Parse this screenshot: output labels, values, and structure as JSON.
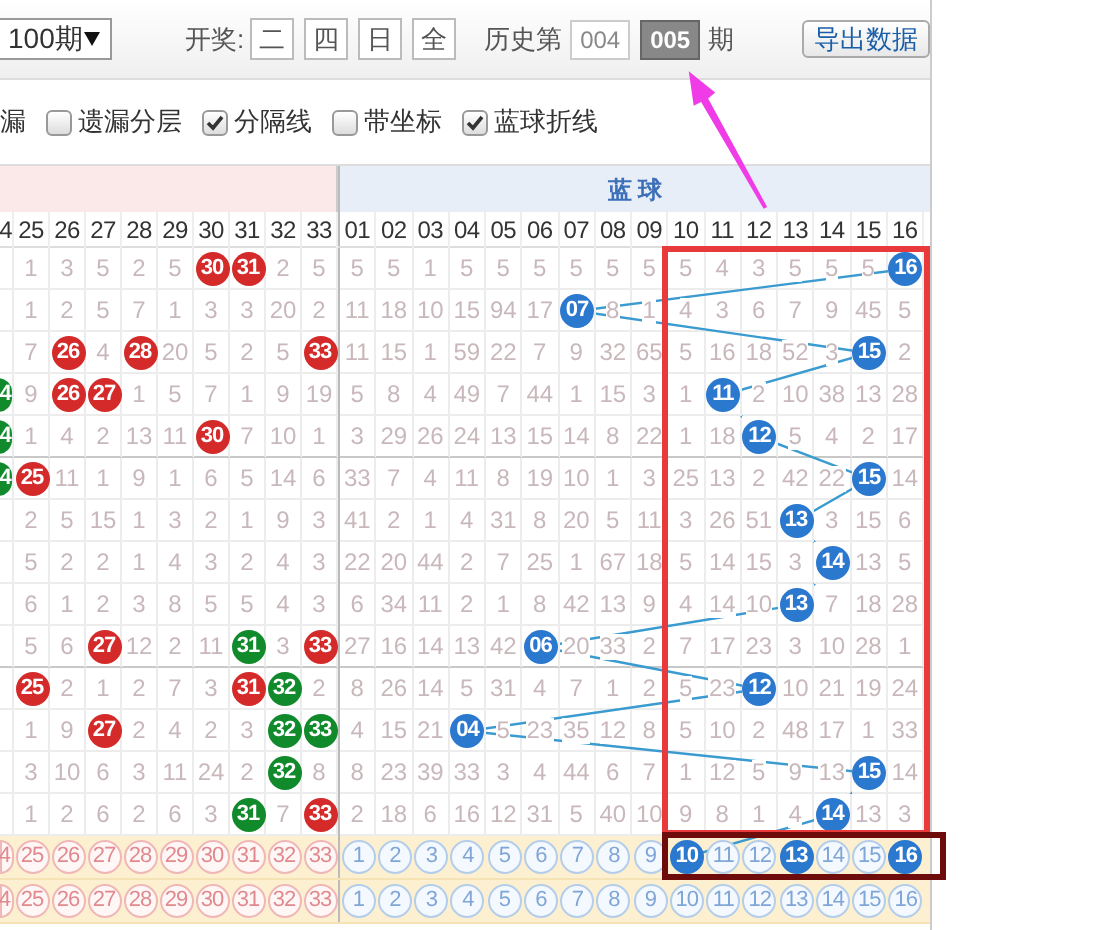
{
  "toolbar": {
    "period_select": {
      "value": "100期"
    },
    "draw_label": "开奖:",
    "draw_days": [
      {
        "label": "二"
      },
      {
        "label": "四"
      },
      {
        "label": "日"
      },
      {
        "label": "全"
      }
    ],
    "history_label": "历史第",
    "history_periods": [
      {
        "label": "004",
        "selected": false
      },
      {
        "label": "005",
        "selected": true
      }
    ],
    "history_suffix": "期",
    "export_button": "导出数据"
  },
  "options": {
    "cut_label": "漏",
    "checkboxes": [
      {
        "label": "遗漏分层",
        "checked": false
      },
      {
        "label": "分隔线",
        "checked": true
      },
      {
        "label": "带坐标",
        "checked": false
      },
      {
        "label": "蓝球折线",
        "checked": true
      }
    ]
  },
  "table": {
    "blue_header": "蓝 球",
    "red_columns": [
      "4",
      "25",
      "26",
      "27",
      "28",
      "29",
      "30",
      "31",
      "32",
      "33"
    ],
    "blue_columns": [
      "01",
      "02",
      "03",
      "04",
      "05",
      "06",
      "07",
      "08",
      "09",
      "10",
      "11",
      "12",
      "13",
      "14",
      "15",
      "16"
    ],
    "rows": [
      {
        "cells": [
          {
            "kind": "blank"
          },
          {
            "text": "1",
            "kind": "miss"
          },
          {
            "text": "3",
            "kind": "miss"
          },
          {
            "text": "5",
            "kind": "miss"
          },
          {
            "text": "2",
            "kind": "miss"
          },
          {
            "text": "5",
            "kind": "miss"
          },
          {
            "text": "30",
            "kind": "red"
          },
          {
            "text": "31",
            "kind": "red"
          },
          {
            "text": "2",
            "kind": "miss"
          },
          {
            "text": "5",
            "kind": "miss"
          },
          {
            "text": "5",
            "kind": "miss"
          },
          {
            "text": "5",
            "kind": "miss"
          },
          {
            "text": "1",
            "kind": "miss"
          },
          {
            "text": "5",
            "kind": "miss"
          },
          {
            "text": "5",
            "kind": "miss"
          },
          {
            "text": "5",
            "kind": "miss"
          },
          {
            "text": "5",
            "kind": "miss"
          },
          {
            "text": "5",
            "kind": "miss"
          },
          {
            "text": "5",
            "kind": "miss"
          },
          {
            "text": "5",
            "kind": "miss"
          },
          {
            "text": "4",
            "kind": "miss"
          },
          {
            "text": "3",
            "kind": "miss"
          },
          {
            "text": "5",
            "kind": "miss"
          },
          {
            "text": "5",
            "kind": "miss"
          },
          {
            "text": "5",
            "kind": "miss"
          },
          {
            "text": "16",
            "kind": "blue"
          }
        ]
      },
      {
        "cells": [
          {
            "kind": "blank"
          },
          {
            "text": "1",
            "kind": "miss"
          },
          {
            "text": "2",
            "kind": "miss"
          },
          {
            "text": "5",
            "kind": "miss"
          },
          {
            "text": "7",
            "kind": "miss"
          },
          {
            "text": "1",
            "kind": "miss"
          },
          {
            "text": "3",
            "kind": "miss"
          },
          {
            "text": "3",
            "kind": "miss"
          },
          {
            "text": "20",
            "kind": "miss"
          },
          {
            "text": "2",
            "kind": "miss"
          },
          {
            "text": "11",
            "kind": "miss"
          },
          {
            "text": "18",
            "kind": "miss"
          },
          {
            "text": "10",
            "kind": "miss"
          },
          {
            "text": "15",
            "kind": "miss"
          },
          {
            "text": "94",
            "kind": "miss"
          },
          {
            "text": "17",
            "kind": "miss"
          },
          {
            "text": "07",
            "kind": "blue"
          },
          {
            "text": "8",
            "kind": "miss"
          },
          {
            "text": "1",
            "kind": "miss"
          },
          {
            "text": "4",
            "kind": "miss"
          },
          {
            "text": "3",
            "kind": "miss"
          },
          {
            "text": "6",
            "kind": "miss"
          },
          {
            "text": "7",
            "kind": "miss"
          },
          {
            "text": "9",
            "kind": "miss"
          },
          {
            "text": "45",
            "kind": "miss"
          },
          {
            "text": "5",
            "kind": "miss"
          }
        ]
      },
      {
        "cells": [
          {
            "kind": "blank"
          },
          {
            "text": "7",
            "kind": "miss"
          },
          {
            "text": "26",
            "kind": "red"
          },
          {
            "text": "4",
            "kind": "miss"
          },
          {
            "text": "28",
            "kind": "red"
          },
          {
            "text": "20",
            "kind": "miss"
          },
          {
            "text": "5",
            "kind": "miss"
          },
          {
            "text": "2",
            "kind": "miss"
          },
          {
            "text": "5",
            "kind": "miss"
          },
          {
            "text": "33",
            "kind": "red"
          },
          {
            "text": "11",
            "kind": "miss"
          },
          {
            "text": "15",
            "kind": "miss"
          },
          {
            "text": "1",
            "kind": "miss"
          },
          {
            "text": "59",
            "kind": "miss"
          },
          {
            "text": "22",
            "kind": "miss"
          },
          {
            "text": "7",
            "kind": "miss"
          },
          {
            "text": "9",
            "kind": "miss"
          },
          {
            "text": "32",
            "kind": "miss"
          },
          {
            "text": "65",
            "kind": "miss"
          },
          {
            "text": "5",
            "kind": "miss"
          },
          {
            "text": "16",
            "kind": "miss"
          },
          {
            "text": "18",
            "kind": "miss"
          },
          {
            "text": "52",
            "kind": "miss"
          },
          {
            "text": "3",
            "kind": "miss"
          },
          {
            "text": "15",
            "kind": "blue"
          },
          {
            "text": "2",
            "kind": "miss"
          }
        ]
      },
      {
        "cells": [
          {
            "text": "4",
            "kind": "green"
          },
          {
            "text": "9",
            "kind": "miss"
          },
          {
            "text": "26",
            "kind": "red"
          },
          {
            "text": "27",
            "kind": "red"
          },
          {
            "text": "1",
            "kind": "miss"
          },
          {
            "text": "5",
            "kind": "miss"
          },
          {
            "text": "7",
            "kind": "miss"
          },
          {
            "text": "1",
            "kind": "miss"
          },
          {
            "text": "9",
            "kind": "miss"
          },
          {
            "text": "19",
            "kind": "miss"
          },
          {
            "text": "5",
            "kind": "miss"
          },
          {
            "text": "8",
            "kind": "miss"
          },
          {
            "text": "4",
            "kind": "miss"
          },
          {
            "text": "49",
            "kind": "miss"
          },
          {
            "text": "7",
            "kind": "miss"
          },
          {
            "text": "44",
            "kind": "miss"
          },
          {
            "text": "1",
            "kind": "miss"
          },
          {
            "text": "15",
            "kind": "miss"
          },
          {
            "text": "3",
            "kind": "miss"
          },
          {
            "text": "1",
            "kind": "miss"
          },
          {
            "text": "11",
            "kind": "blue"
          },
          {
            "text": "2",
            "kind": "miss"
          },
          {
            "text": "10",
            "kind": "miss"
          },
          {
            "text": "38",
            "kind": "miss"
          },
          {
            "text": "13",
            "kind": "miss"
          },
          {
            "text": "28",
            "kind": "miss"
          }
        ]
      },
      {
        "cells": [
          {
            "text": "4",
            "kind": "green"
          },
          {
            "text": "1",
            "kind": "miss"
          },
          {
            "text": "4",
            "kind": "miss"
          },
          {
            "text": "2",
            "kind": "miss"
          },
          {
            "text": "13",
            "kind": "miss"
          },
          {
            "text": "11",
            "kind": "miss"
          },
          {
            "text": "30",
            "kind": "red"
          },
          {
            "text": "7",
            "kind": "miss"
          },
          {
            "text": "10",
            "kind": "miss"
          },
          {
            "text": "1",
            "kind": "miss"
          },
          {
            "text": "3",
            "kind": "miss"
          },
          {
            "text": "29",
            "kind": "miss"
          },
          {
            "text": "26",
            "kind": "miss"
          },
          {
            "text": "24",
            "kind": "miss"
          },
          {
            "text": "13",
            "kind": "miss"
          },
          {
            "text": "15",
            "kind": "miss"
          },
          {
            "text": "14",
            "kind": "miss"
          },
          {
            "text": "8",
            "kind": "miss"
          },
          {
            "text": "22",
            "kind": "miss"
          },
          {
            "text": "1",
            "kind": "miss"
          },
          {
            "text": "18",
            "kind": "miss"
          },
          {
            "text": "12",
            "kind": "blue"
          },
          {
            "text": "5",
            "kind": "miss"
          },
          {
            "text": "4",
            "kind": "miss"
          },
          {
            "text": "2",
            "kind": "miss"
          },
          {
            "text": "17",
            "kind": "miss"
          }
        ]
      },
      {
        "cells": [
          {
            "text": "4",
            "kind": "green"
          },
          {
            "text": "25",
            "kind": "red"
          },
          {
            "text": "11",
            "kind": "miss"
          },
          {
            "text": "1",
            "kind": "miss"
          },
          {
            "text": "9",
            "kind": "miss"
          },
          {
            "text": "1",
            "kind": "miss"
          },
          {
            "text": "6",
            "kind": "miss"
          },
          {
            "text": "5",
            "kind": "miss"
          },
          {
            "text": "14",
            "kind": "miss"
          },
          {
            "text": "6",
            "kind": "miss"
          },
          {
            "text": "33",
            "kind": "miss"
          },
          {
            "text": "7",
            "kind": "miss"
          },
          {
            "text": "4",
            "kind": "miss"
          },
          {
            "text": "11",
            "kind": "miss"
          },
          {
            "text": "8",
            "kind": "miss"
          },
          {
            "text": "19",
            "kind": "miss"
          },
          {
            "text": "10",
            "kind": "miss"
          },
          {
            "text": "1",
            "kind": "miss"
          },
          {
            "text": "3",
            "kind": "miss"
          },
          {
            "text": "25",
            "kind": "miss"
          },
          {
            "text": "13",
            "kind": "miss"
          },
          {
            "text": "2",
            "kind": "miss"
          },
          {
            "text": "42",
            "kind": "miss"
          },
          {
            "text": "22",
            "kind": "miss"
          },
          {
            "text": "15",
            "kind": "blue"
          },
          {
            "text": "14",
            "kind": "miss"
          }
        ]
      },
      {
        "cells": [
          {
            "kind": "blank"
          },
          {
            "text": "2",
            "kind": "miss"
          },
          {
            "text": "5",
            "kind": "miss"
          },
          {
            "text": "15",
            "kind": "miss"
          },
          {
            "text": "1",
            "kind": "miss"
          },
          {
            "text": "3",
            "kind": "miss"
          },
          {
            "text": "2",
            "kind": "miss"
          },
          {
            "text": "1",
            "kind": "miss"
          },
          {
            "text": "9",
            "kind": "miss"
          },
          {
            "text": "3",
            "kind": "miss"
          },
          {
            "text": "41",
            "kind": "miss"
          },
          {
            "text": "2",
            "kind": "miss"
          },
          {
            "text": "1",
            "kind": "miss"
          },
          {
            "text": "4",
            "kind": "miss"
          },
          {
            "text": "31",
            "kind": "miss"
          },
          {
            "text": "8",
            "kind": "miss"
          },
          {
            "text": "20",
            "kind": "miss"
          },
          {
            "text": "5",
            "kind": "miss"
          },
          {
            "text": "11",
            "kind": "miss"
          },
          {
            "text": "3",
            "kind": "miss"
          },
          {
            "text": "26",
            "kind": "miss"
          },
          {
            "text": "51",
            "kind": "miss"
          },
          {
            "text": "13",
            "kind": "blue"
          },
          {
            "text": "3",
            "kind": "miss"
          },
          {
            "text": "15",
            "kind": "miss"
          },
          {
            "text": "6",
            "kind": "miss"
          }
        ]
      },
      {
        "cells": [
          {
            "kind": "blank"
          },
          {
            "text": "5",
            "kind": "miss"
          },
          {
            "text": "2",
            "kind": "miss"
          },
          {
            "text": "2",
            "kind": "miss"
          },
          {
            "text": "1",
            "kind": "miss"
          },
          {
            "text": "4",
            "kind": "miss"
          },
          {
            "text": "3",
            "kind": "miss"
          },
          {
            "text": "2",
            "kind": "miss"
          },
          {
            "text": "4",
            "kind": "miss"
          },
          {
            "text": "3",
            "kind": "miss"
          },
          {
            "text": "22",
            "kind": "miss"
          },
          {
            "text": "20",
            "kind": "miss"
          },
          {
            "text": "44",
            "kind": "miss"
          },
          {
            "text": "2",
            "kind": "miss"
          },
          {
            "text": "7",
            "kind": "miss"
          },
          {
            "text": "25",
            "kind": "miss"
          },
          {
            "text": "1",
            "kind": "miss"
          },
          {
            "text": "67",
            "kind": "miss"
          },
          {
            "text": "18",
            "kind": "miss"
          },
          {
            "text": "5",
            "kind": "miss"
          },
          {
            "text": "14",
            "kind": "miss"
          },
          {
            "text": "15",
            "kind": "miss"
          },
          {
            "text": "3",
            "kind": "miss"
          },
          {
            "text": "14",
            "kind": "blue"
          },
          {
            "text": "13",
            "kind": "miss"
          },
          {
            "text": "5",
            "kind": "miss"
          }
        ]
      },
      {
        "cells": [
          {
            "kind": "blank"
          },
          {
            "text": "6",
            "kind": "miss"
          },
          {
            "text": "1",
            "kind": "miss"
          },
          {
            "text": "2",
            "kind": "miss"
          },
          {
            "text": "3",
            "kind": "miss"
          },
          {
            "text": "8",
            "kind": "miss"
          },
          {
            "text": "5",
            "kind": "miss"
          },
          {
            "text": "5",
            "kind": "miss"
          },
          {
            "text": "4",
            "kind": "miss"
          },
          {
            "text": "3",
            "kind": "miss"
          },
          {
            "text": "6",
            "kind": "miss"
          },
          {
            "text": "34",
            "kind": "miss"
          },
          {
            "text": "11",
            "kind": "miss"
          },
          {
            "text": "2",
            "kind": "miss"
          },
          {
            "text": "1",
            "kind": "miss"
          },
          {
            "text": "8",
            "kind": "miss"
          },
          {
            "text": "42",
            "kind": "miss"
          },
          {
            "text": "13",
            "kind": "miss"
          },
          {
            "text": "9",
            "kind": "miss"
          },
          {
            "text": "4",
            "kind": "miss"
          },
          {
            "text": "14",
            "kind": "miss"
          },
          {
            "text": "10",
            "kind": "miss"
          },
          {
            "text": "13",
            "kind": "blue"
          },
          {
            "text": "7",
            "kind": "miss"
          },
          {
            "text": "18",
            "kind": "miss"
          },
          {
            "text": "28",
            "kind": "miss"
          }
        ]
      },
      {
        "cells": [
          {
            "kind": "blank"
          },
          {
            "text": "5",
            "kind": "miss"
          },
          {
            "text": "6",
            "kind": "miss"
          },
          {
            "text": "27",
            "kind": "red"
          },
          {
            "text": "12",
            "kind": "miss"
          },
          {
            "text": "2",
            "kind": "miss"
          },
          {
            "text": "11",
            "kind": "miss"
          },
          {
            "text": "31",
            "kind": "green"
          },
          {
            "text": "3",
            "kind": "miss"
          },
          {
            "text": "33",
            "kind": "red"
          },
          {
            "text": "27",
            "kind": "miss"
          },
          {
            "text": "16",
            "kind": "miss"
          },
          {
            "text": "14",
            "kind": "miss"
          },
          {
            "text": "13",
            "kind": "miss"
          },
          {
            "text": "42",
            "kind": "miss"
          },
          {
            "text": "06",
            "kind": "blue"
          },
          {
            "text": "20",
            "kind": "miss"
          },
          {
            "text": "33",
            "kind": "miss"
          },
          {
            "text": "2",
            "kind": "miss"
          },
          {
            "text": "7",
            "kind": "miss"
          },
          {
            "text": "17",
            "kind": "miss"
          },
          {
            "text": "23",
            "kind": "miss"
          },
          {
            "text": "3",
            "kind": "miss"
          },
          {
            "text": "10",
            "kind": "miss"
          },
          {
            "text": "28",
            "kind": "miss"
          },
          {
            "text": "1",
            "kind": "miss"
          }
        ]
      },
      {
        "cells": [
          {
            "kind": "blank"
          },
          {
            "text": "25",
            "kind": "red"
          },
          {
            "text": "2",
            "kind": "miss"
          },
          {
            "text": "1",
            "kind": "miss"
          },
          {
            "text": "2",
            "kind": "miss"
          },
          {
            "text": "7",
            "kind": "miss"
          },
          {
            "text": "3",
            "kind": "miss"
          },
          {
            "text": "31",
            "kind": "red"
          },
          {
            "text": "32",
            "kind": "green"
          },
          {
            "text": "2",
            "kind": "miss"
          },
          {
            "text": "8",
            "kind": "miss"
          },
          {
            "text": "26",
            "kind": "miss"
          },
          {
            "text": "14",
            "kind": "miss"
          },
          {
            "text": "5",
            "kind": "miss"
          },
          {
            "text": "31",
            "kind": "miss"
          },
          {
            "text": "4",
            "kind": "miss"
          },
          {
            "text": "7",
            "kind": "miss"
          },
          {
            "text": "1",
            "kind": "miss"
          },
          {
            "text": "2",
            "kind": "miss"
          },
          {
            "text": "5",
            "kind": "miss"
          },
          {
            "text": "23",
            "kind": "miss"
          },
          {
            "text": "12",
            "kind": "blue"
          },
          {
            "text": "10",
            "kind": "miss"
          },
          {
            "text": "21",
            "kind": "miss"
          },
          {
            "text": "19",
            "kind": "miss"
          },
          {
            "text": "24",
            "kind": "miss"
          }
        ]
      },
      {
        "cells": [
          {
            "kind": "blank"
          },
          {
            "text": "1",
            "kind": "miss"
          },
          {
            "text": "9",
            "kind": "miss"
          },
          {
            "text": "27",
            "kind": "red"
          },
          {
            "text": "2",
            "kind": "miss"
          },
          {
            "text": "4",
            "kind": "miss"
          },
          {
            "text": "2",
            "kind": "miss"
          },
          {
            "text": "3",
            "kind": "miss"
          },
          {
            "text": "32",
            "kind": "green"
          },
          {
            "text": "33",
            "kind": "green"
          },
          {
            "text": "4",
            "kind": "miss"
          },
          {
            "text": "15",
            "kind": "miss"
          },
          {
            "text": "21",
            "kind": "miss"
          },
          {
            "text": "04",
            "kind": "blue"
          },
          {
            "text": "5",
            "kind": "miss"
          },
          {
            "text": "23",
            "kind": "miss"
          },
          {
            "text": "35",
            "kind": "miss"
          },
          {
            "text": "12",
            "kind": "miss"
          },
          {
            "text": "8",
            "kind": "miss"
          },
          {
            "text": "5",
            "kind": "miss"
          },
          {
            "text": "10",
            "kind": "miss"
          },
          {
            "text": "2",
            "kind": "miss"
          },
          {
            "text": "48",
            "kind": "miss"
          },
          {
            "text": "17",
            "kind": "miss"
          },
          {
            "text": "1",
            "kind": "miss"
          },
          {
            "text": "33",
            "kind": "miss"
          }
        ]
      },
      {
        "cells": [
          {
            "kind": "blank"
          },
          {
            "text": "3",
            "kind": "miss"
          },
          {
            "text": "10",
            "kind": "miss"
          },
          {
            "text": "6",
            "kind": "miss"
          },
          {
            "text": "3",
            "kind": "miss"
          },
          {
            "text": "11",
            "kind": "miss"
          },
          {
            "text": "24",
            "kind": "miss"
          },
          {
            "text": "2",
            "kind": "miss"
          },
          {
            "text": "32",
            "kind": "green"
          },
          {
            "text": "8",
            "kind": "miss"
          },
          {
            "text": "8",
            "kind": "miss"
          },
          {
            "text": "23",
            "kind": "miss"
          },
          {
            "text": "39",
            "kind": "miss"
          },
          {
            "text": "33",
            "kind": "miss"
          },
          {
            "text": "3",
            "kind": "miss"
          },
          {
            "text": "4",
            "kind": "miss"
          },
          {
            "text": "44",
            "kind": "miss"
          },
          {
            "text": "6",
            "kind": "miss"
          },
          {
            "text": "7",
            "kind": "miss"
          },
          {
            "text": "1",
            "kind": "miss"
          },
          {
            "text": "12",
            "kind": "miss"
          },
          {
            "text": "5",
            "kind": "miss"
          },
          {
            "text": "9",
            "kind": "miss"
          },
          {
            "text": "13",
            "kind": "miss"
          },
          {
            "text": "15",
            "kind": "blue"
          },
          {
            "text": "14",
            "kind": "miss"
          }
        ]
      },
      {
        "cells": [
          {
            "kind": "blank"
          },
          {
            "text": "1",
            "kind": "miss"
          },
          {
            "text": "2",
            "kind": "miss"
          },
          {
            "text": "6",
            "kind": "miss"
          },
          {
            "text": "2",
            "kind": "miss"
          },
          {
            "text": "6",
            "kind": "miss"
          },
          {
            "text": "3",
            "kind": "miss"
          },
          {
            "text": "31",
            "kind": "green"
          },
          {
            "text": "7",
            "kind": "miss"
          },
          {
            "text": "33",
            "kind": "red"
          },
          {
            "text": "2",
            "kind": "miss"
          },
          {
            "text": "18",
            "kind": "miss"
          },
          {
            "text": "6",
            "kind": "miss"
          },
          {
            "text": "16",
            "kind": "miss"
          },
          {
            "text": "12",
            "kind": "miss"
          },
          {
            "text": "31",
            "kind": "miss"
          },
          {
            "text": "5",
            "kind": "miss"
          },
          {
            "text": "40",
            "kind": "miss"
          },
          {
            "text": "10",
            "kind": "miss"
          },
          {
            "text": "9",
            "kind": "miss"
          },
          {
            "text": "8",
            "kind": "miss"
          },
          {
            "text": "1",
            "kind": "miss"
          },
          {
            "text": "4",
            "kind": "miss"
          },
          {
            "text": "14",
            "kind": "blue"
          },
          {
            "text": "13",
            "kind": "miss"
          },
          {
            "text": "3",
            "kind": "miss"
          }
        ]
      }
    ],
    "footer_rows": [
      {
        "cells": [
          {
            "text": "4",
            "kind": "red",
            "selected": false
          },
          {
            "text": "25",
            "kind": "red",
            "selected": false
          },
          {
            "text": "26",
            "kind": "red",
            "selected": false
          },
          {
            "text": "27",
            "kind": "red",
            "selected": false
          },
          {
            "text": "28",
            "kind": "red",
            "selected": false
          },
          {
            "text": "29",
            "kind": "red",
            "selected": false
          },
          {
            "text": "30",
            "kind": "red",
            "selected": false
          },
          {
            "text": "31",
            "kind": "red",
            "selected": false
          },
          {
            "text": "32",
            "kind": "red",
            "selected": false
          },
          {
            "text": "33",
            "kind": "red",
            "selected": false
          },
          {
            "text": "1",
            "kind": "blue",
            "selected": false
          },
          {
            "text": "2",
            "kind": "blue",
            "selected": false
          },
          {
            "text": "3",
            "kind": "blue",
            "selected": false
          },
          {
            "text": "4",
            "kind": "blue",
            "selected": false
          },
          {
            "text": "5",
            "kind": "blue",
            "selected": false
          },
          {
            "text": "6",
            "kind": "blue",
            "selected": false
          },
          {
            "text": "7",
            "kind": "blue",
            "selected": false
          },
          {
            "text": "8",
            "kind": "blue",
            "selected": false
          },
          {
            "text": "9",
            "kind": "blue",
            "selected": false
          },
          {
            "text": "10",
            "kind": "blue",
            "selected": true
          },
          {
            "text": "11",
            "kind": "blue",
            "selected": false
          },
          {
            "text": "12",
            "kind": "blue",
            "selected": false
          },
          {
            "text": "13",
            "kind": "blue",
            "selected": true
          },
          {
            "text": "14",
            "kind": "blue",
            "selected": false
          },
          {
            "text": "15",
            "kind": "blue",
            "selected": false
          },
          {
            "text": "16",
            "kind": "blue",
            "selected": true
          }
        ]
      },
      {
        "cells": [
          {
            "text": "4",
            "kind": "red",
            "selected": false
          },
          {
            "text": "25",
            "kind": "red",
            "selected": false
          },
          {
            "text": "26",
            "kind": "red",
            "selected": false
          },
          {
            "text": "27",
            "kind": "red",
            "selected": false
          },
          {
            "text": "28",
            "kind": "red",
            "selected": false
          },
          {
            "text": "29",
            "kind": "red",
            "selected": false
          },
          {
            "text": "30",
            "kind": "red",
            "selected": false
          },
          {
            "text": "31",
            "kind": "red",
            "selected": false
          },
          {
            "text": "32",
            "kind": "red",
            "selected": false
          },
          {
            "text": "33",
            "kind": "red",
            "selected": false
          },
          {
            "text": "1",
            "kind": "blue",
            "selected": false
          },
          {
            "text": "2",
            "kind": "blue",
            "selected": false
          },
          {
            "text": "3",
            "kind": "blue",
            "selected": false
          },
          {
            "text": "4",
            "kind": "blue",
            "selected": false
          },
          {
            "text": "5",
            "kind": "blue",
            "selected": false
          },
          {
            "text": "6",
            "kind": "blue",
            "selected": false
          },
          {
            "text": "7",
            "kind": "blue",
            "selected": false
          },
          {
            "text": "8",
            "kind": "blue",
            "selected": false
          },
          {
            "text": "9",
            "kind": "blue",
            "selected": false
          },
          {
            "text": "10",
            "kind": "blue",
            "selected": false
          },
          {
            "text": "11",
            "kind": "blue",
            "selected": false
          },
          {
            "text": "12",
            "kind": "blue",
            "selected": false
          },
          {
            "text": "13",
            "kind": "blue",
            "selected": false
          },
          {
            "text": "14",
            "kind": "blue",
            "selected": false
          },
          {
            "text": "15",
            "kind": "blue",
            "selected": false
          },
          {
            "text": "16",
            "kind": "blue",
            "selected": false
          }
        ]
      }
    ]
  }
}
